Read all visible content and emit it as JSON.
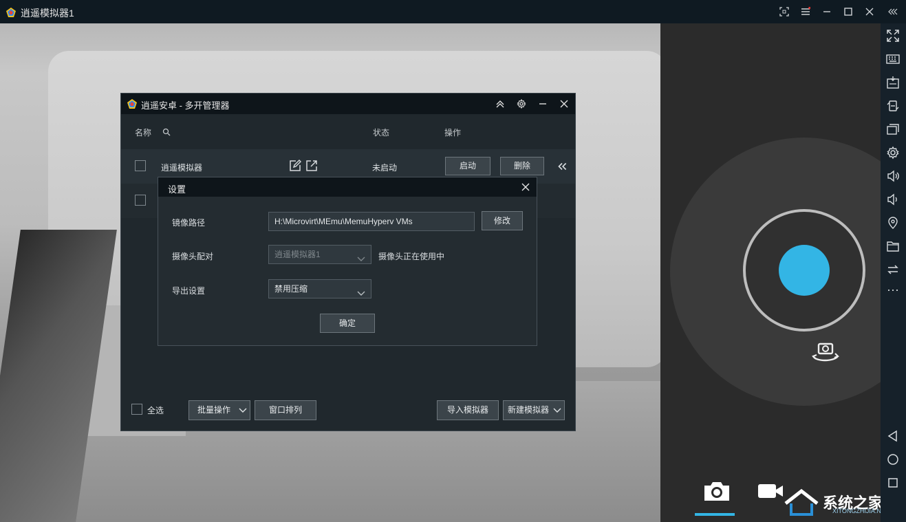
{
  "window": {
    "title": "逍遥模拟器1"
  },
  "manager": {
    "title": "逍遥安卓 - 多开管理器",
    "columns": {
      "name": "名称",
      "status": "状态",
      "actions": "操作"
    },
    "rows": [
      {
        "name": "逍遥模拟器",
        "status": "未启动",
        "start_label": "启动",
        "delete_label": "删除"
      }
    ],
    "footer": {
      "select_all": "全选",
      "batch_ops": "批量操作",
      "window_arrange": "窗口排列",
      "import_emulator": "导入模拟器",
      "new_emulator": "新建模拟器"
    }
  },
  "settings": {
    "title": "设置",
    "image_path_label": "镜像路径",
    "image_path_value": "H:\\Microvirt\\MEmu\\MemuHyperv VMs",
    "modify_label": "修改",
    "camera_label": "摄像头配对",
    "camera_value": "逍遥模拟器1",
    "camera_status": "摄像头正在使用中",
    "export_label": "导出设置",
    "export_value": "禁用压缩",
    "confirm_label": "确定"
  },
  "watermark": {
    "text": "系统之家",
    "url": "XITONGZHIJIA.NET"
  },
  "colors": {
    "accent": "#33b5e5",
    "titlebar": "#0f1a22",
    "dialog_bg": "#242c31"
  }
}
